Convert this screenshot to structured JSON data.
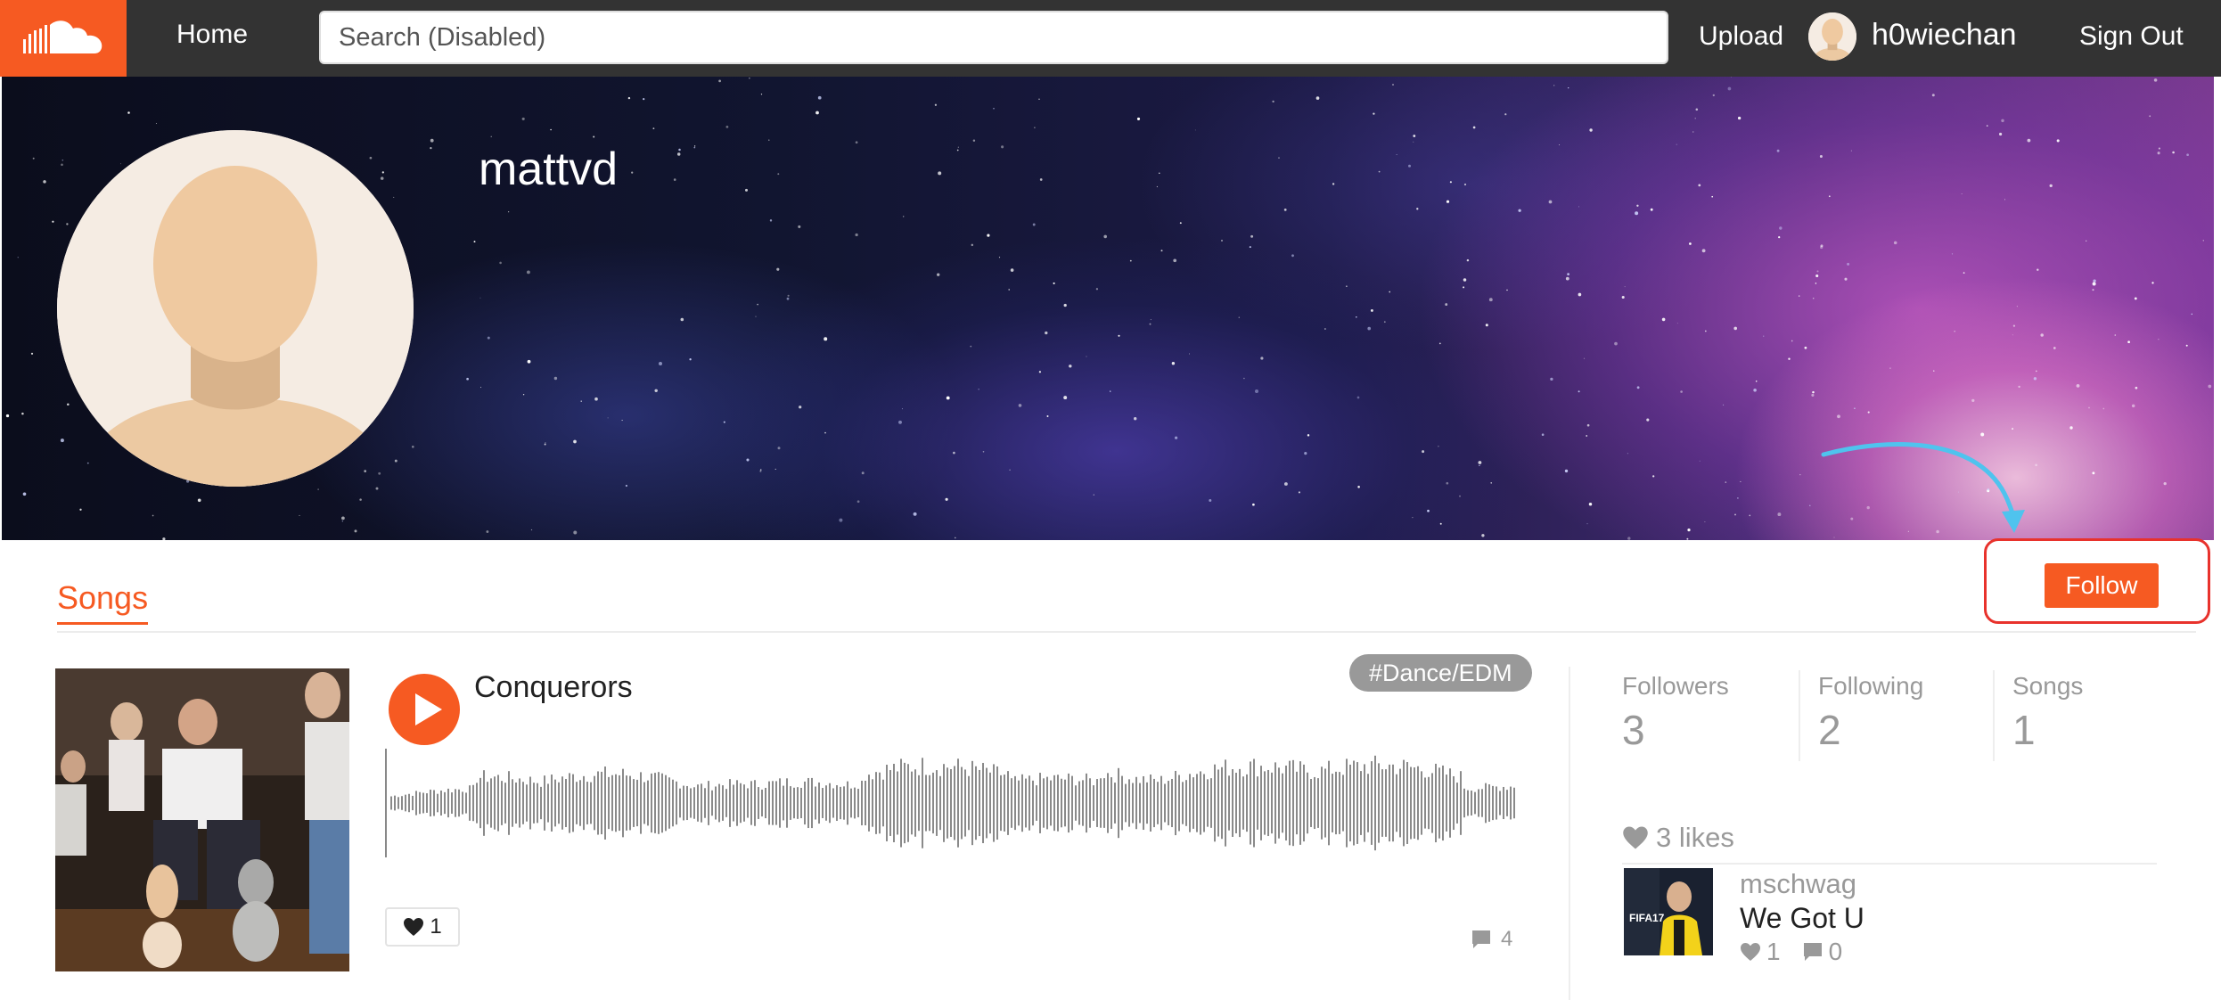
{
  "navbar": {
    "home_label": "Home",
    "search_placeholder": "Search (Disabled)",
    "upload_label": "Upload",
    "username": "h0wiechan",
    "signout_label": "Sign Out",
    "brand_color": "#f65a22",
    "logo_icon": "soundcloud-cloud-icon"
  },
  "profile": {
    "name": "mattvd",
    "follow_label": "Follow"
  },
  "tabs": {
    "songs_label": "Songs"
  },
  "song": {
    "title": "Conquerors",
    "genre_tag": "#Dance/EDM",
    "like_count": "1",
    "comment_count": "4"
  },
  "stats": {
    "followers_label": "Followers",
    "followers_value": "3",
    "following_label": "Following",
    "following_value": "2",
    "songs_label": "Songs",
    "songs_value": "1"
  },
  "likes": {
    "header": "3 likes",
    "item": {
      "user": "mschwag",
      "title": "We Got U",
      "like_count": "1",
      "comment_count": "0"
    }
  }
}
